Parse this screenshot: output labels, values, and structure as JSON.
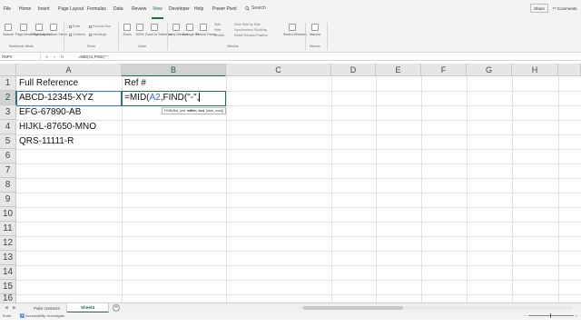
{
  "ribbon_tabs": [
    "File",
    "Home",
    "Insert",
    "Page Layout",
    "Formulas",
    "Data",
    "Review",
    "View",
    "Developer",
    "Help",
    "Power Pivot"
  ],
  "active_tab": "View",
  "search_label": "Search",
  "share_label": "Share",
  "comments_label": "Comments",
  "ribbon": {
    "workbook_views": {
      "label": "Workbook Views",
      "buttons": [
        "Normal",
        "Page Break Preview",
        "Page Layout",
        "Custom Views"
      ]
    },
    "show": {
      "label": "Show",
      "checks": [
        "Ruler",
        "Gridlines",
        "Formula Bar",
        "Headings"
      ]
    },
    "zoom": {
      "label": "Zoom",
      "buttons": [
        "Zoom",
        "100%",
        "Zoom to Selection"
      ]
    },
    "window": {
      "label": "Window",
      "buttons": [
        "New Window",
        "Arrange All",
        "Freeze Panes"
      ],
      "small": [
        "Split",
        "Hide",
        "Unhide",
        "View Side by Side",
        "Synchronous Scrolling",
        "Reset Window Position"
      ],
      "switch": "Switch Windows"
    },
    "macros": {
      "label": "Macros",
      "button": "Macros"
    }
  },
  "formula_bar": {
    "name_box": "XNPV",
    "icons": [
      "✕",
      "✓",
      "fx"
    ],
    "content": "=MID(A2,FIND(\"-\","
  },
  "columns": [
    "A",
    "B",
    "C",
    "D",
    "E",
    "F",
    "G",
    "H"
  ],
  "rows": [
    "1",
    "2",
    "3",
    "4",
    "5",
    "6",
    "7",
    "8",
    "9",
    "10",
    "11",
    "12",
    "13",
    "14",
    "15",
    "16"
  ],
  "cells": {
    "A1": "Full Reference",
    "B1": "Ref #",
    "A2": "ABCD-12345-XYZ",
    "A3": "EFG-67890-AB",
    "A4": "HIJKL-87650-MNO",
    "A5": "QRS-11111-R"
  },
  "active_formula": {
    "prefix": "=MID(",
    "ref": "A2",
    "middle": ",FIND(",
    "string_arg": "\"-\"",
    "suffix": ","
  },
  "tooltip": {
    "func": "FIND(find_text, ",
    "bold_arg": "within_text",
    "rest": ", [start_num])"
  },
  "sheet_tabs": [
    "Fake contacts",
    "Sheet4"
  ],
  "active_sheet": "Sheet4",
  "status": {
    "mode": "Enter",
    "accessibility": "Accessibility: Investigate"
  },
  "colors": {
    "accent": "#217346",
    "ref_blue": "#2f6fd6"
  }
}
